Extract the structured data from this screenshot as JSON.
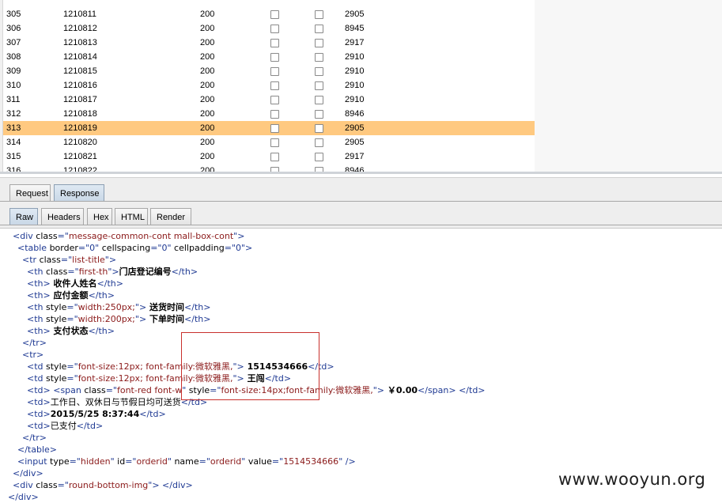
{
  "results": {
    "rows": [
      {
        "num": "305",
        "payload": "1210811",
        "status": "200",
        "len": "2905"
      },
      {
        "num": "306",
        "payload": "1210812",
        "status": "200",
        "len": "8945"
      },
      {
        "num": "307",
        "payload": "1210813",
        "status": "200",
        "len": "2917"
      },
      {
        "num": "308",
        "payload": "1210814",
        "status": "200",
        "len": "2910"
      },
      {
        "num": "309",
        "payload": "1210815",
        "status": "200",
        "len": "2910"
      },
      {
        "num": "310",
        "payload": "1210816",
        "status": "200",
        "len": "2910"
      },
      {
        "num": "311",
        "payload": "1210817",
        "status": "200",
        "len": "2910"
      },
      {
        "num": "312",
        "payload": "1210818",
        "status": "200",
        "len": "8946"
      },
      {
        "num": "313",
        "payload": "1210819",
        "status": "200",
        "len": "2905",
        "selected": true
      },
      {
        "num": "314",
        "payload": "1210820",
        "status": "200",
        "len": "2905"
      },
      {
        "num": "315",
        "payload": "1210821",
        "status": "200",
        "len": "2917"
      },
      {
        "num": "316",
        "payload": "1210822",
        "status": "200",
        "len": "8946"
      }
    ],
    "selected_color": "#ffc980"
  },
  "tabs": {
    "request": "Request",
    "response": "Response",
    "raw": "Raw",
    "headers": "Headers",
    "hex": "Hex",
    "html": "HTML",
    "render": "Render"
  },
  "code": {
    "l1": {
      "a": "<div ",
      "b": "class",
      "c": "=\"",
      "d": "message-common-cont mall-box-cont",
      "e": "\">"
    },
    "l2": {
      "a": "<table ",
      "b": "border",
      "c": "=\"0\" ",
      "d": "cellspacing",
      "e": "=\"0\" ",
      "f": "cellpadding",
      "g": "=\"0\">"
    },
    "l3": {
      "a": "<tr ",
      "b": "class",
      "c": "=\"",
      "d": "list-title",
      "e": "\">"
    },
    "l4": {
      "a": "<th ",
      "b": "class",
      "c": "=\"",
      "d": "first-th",
      "e": "\">",
      "t": "门店登记编号",
      "z": "</th>"
    },
    "l5": {
      "a": "<th>",
      "t": " 收件人姓名",
      "z": "</th>"
    },
    "l6": {
      "a": "<th>",
      "t": " 应付金额",
      "z": "</th>"
    },
    "l7": {
      "a": "<th ",
      "b": "style",
      "c": "=\"",
      "d": "width:250px;",
      "e": "\">",
      "t": " 送货时间",
      "z": "</th>"
    },
    "l8": {
      "a": "<th ",
      "b": "style",
      "c": "=\"",
      "d": "width:200px;",
      "e": "\">",
      "t": " 下单时间",
      "z": "</th>"
    },
    "l9": {
      "a": "<th>",
      "t": " 支付状态",
      "z": "</th>"
    },
    "l10": {
      "a": "</tr>"
    },
    "l11": {
      "a": "<tr>"
    },
    "l12": {
      "a": "<td ",
      "b": "style",
      "c": "=\"",
      "d": "font-size:12px; font-family:微软雅黑,",
      "e": "\">",
      "t": " 1514534666",
      "z": "</td>"
    },
    "l13": {
      "a": "<td ",
      "b": "style",
      "c": "=\"",
      "d": "font-size:12px; font-family:微软雅黑,",
      "e": "\">",
      "t": " 王闯",
      "z": "</td>"
    },
    "l14": {
      "a": "<td>",
      "a2": " <span ",
      "b": "class",
      "c": "=\"",
      "d": "font-red font-w",
      "e": "\" ",
      "f": "style",
      "g": "=\"",
      "h": "font-size:14px;font-family:微软雅黑,",
      "i": "\">",
      "t": " ￥0.00",
      "z": "</span>",
      "z2": " </td>"
    },
    "l15": {
      "a": "<td>",
      "t": "工作日、双休日与节假日均可送货",
      "z": "</td>"
    },
    "l16": {
      "a": "<td>",
      "t": "2015/5/25 8:37:44",
      "z": "</td>"
    },
    "l17": {
      "a": "<td>",
      "t": "已支付",
      "z": "</td>"
    },
    "l18": {
      "a": "</tr>"
    },
    "l19": {
      "a": "</table>"
    },
    "l20": {
      "a": "<input ",
      "b": "type",
      "c": "=\"",
      "d": "hidden",
      "e": "\" ",
      "f": "id",
      "g": "=\"",
      "h": "orderid",
      "i": "\" ",
      "j": "name",
      "k": "=\"",
      "m": "orderid",
      "n": "\" ",
      "o": "value",
      "p": "=\"",
      "q": "1514534666",
      "r": "\" />"
    },
    "l21": {
      "a": "</div>"
    },
    "l22": {
      "a": "<div ",
      "b": "class",
      "c": "=\"",
      "d": "round-bottom-img",
      "e": "\">",
      "z": " </div>"
    },
    "l23": {
      "a": "</div>"
    }
  },
  "watermark": "www.wooyun.org",
  "colors": {
    "highlight_box": "#c9302c",
    "active_tab": "#c8d7e6",
    "tag": "#1f3a93",
    "value": "#8b1a1a"
  }
}
